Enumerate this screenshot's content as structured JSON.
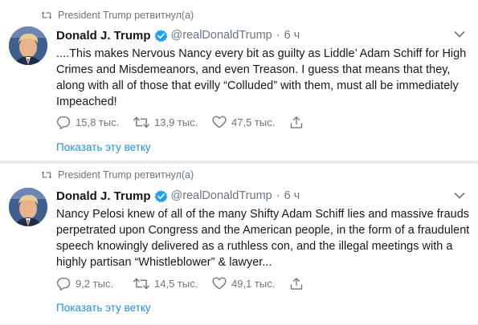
{
  "tweets": [
    {
      "retweeted_by": "President Trump ретвитнул(а)",
      "name": "Donald J. Trump",
      "handle": "@realDonaldTrump",
      "separator": "·",
      "time": "6 ч",
      "text": "....This makes Nervous Nancy every bit as guilty as Liddle’ Adam Schiff for High Crimes and Misdemeanors, and even Treason. I guess that means that they, along with all of those that evilly “Colluded” with them, must all be immediately Impeached!",
      "replies": "15,8 тыс.",
      "retweets": "13,9 тыс.",
      "likes": "47,5 тыс.",
      "thread_link": "Показать эту ветку"
    },
    {
      "retweeted_by": "President Trump ретвитнул(а)",
      "name": "Donald J. Trump",
      "handle": "@realDonaldTrump",
      "separator": "·",
      "time": "6 ч",
      "text": "Nancy Pelosi knew of all of the many Shifty Adam Schiff lies and massive frauds perpetrated upon Congress and the American people, in the form of a fraudulent speech knowingly delivered as a ruthless con, and the illegal meetings with a highly partisan “Whistleblower” & lawyer...",
      "replies": "9,2 тыс.",
      "retweets": "14,5 тыс.",
      "likes": "49,1 тыс.",
      "thread_link": "Показать эту ветку"
    }
  ],
  "icons": {
    "retweeted_marker": "retweet-icon",
    "verified": "verified-badge-icon",
    "caret": "chevron-down-icon",
    "reply": "reply-icon",
    "retweet": "retweet-icon",
    "like": "heart-icon",
    "share": "share-icon"
  },
  "colors": {
    "text": "#14171a",
    "secondary": "#657786",
    "link": "#1b95e0",
    "verified": "#1da1f2",
    "divider": "#e6ecf0"
  }
}
